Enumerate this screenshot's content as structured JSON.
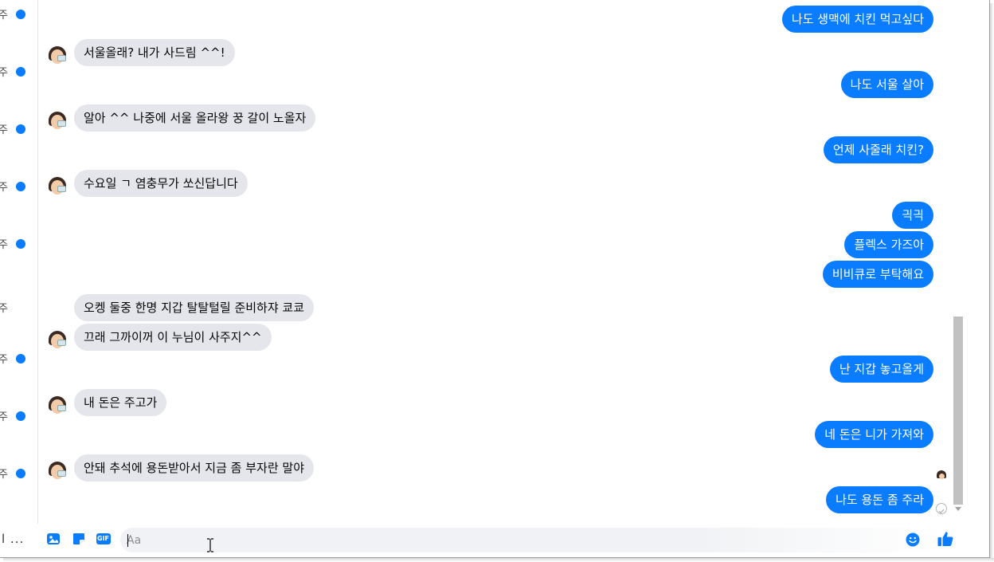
{
  "colors": {
    "accent": "#0a7cff",
    "incoming_bubble": "#e4e6eb",
    "unread_dot": "#0a7cff"
  },
  "sidebar": {
    "rows": [
      {
        "char": "주",
        "unread": true
      },
      {
        "char": "주",
        "unread": true
      },
      {
        "char": "주",
        "unread": true
      },
      {
        "char": "주",
        "unread": true
      },
      {
        "char": "주",
        "unread": true
      },
      {
        "char": "주",
        "unread": false
      },
      {
        "char": "주",
        "unread": true
      },
      {
        "char": "주",
        "unread": true
      },
      {
        "char": "주",
        "unread": true
      }
    ],
    "bottom_text": "l ..."
  },
  "messages": [
    {
      "dir": "out",
      "text": "나도 생맥에 치킨 먹고싶다"
    },
    {
      "dir": "in",
      "text": "서울올래? 내가 사드림 ^^!"
    },
    {
      "dir": "out",
      "text": "나도 서울 살아"
    },
    {
      "dir": "in",
      "text": "알아 ^^ 나중에 서울 올라왕 꿍 갈이 노올자"
    },
    {
      "dir": "out",
      "text": "언제 사줄래 치킨?"
    },
    {
      "dir": "in",
      "text": "수요일 ㄱ 염충무가 쏘신답니다"
    },
    {
      "dir": "out",
      "text": "긕긕"
    },
    {
      "dir": "out",
      "text": "플렉스 가즈아"
    },
    {
      "dir": "out",
      "text": "비비큐로 부탁해요"
    },
    {
      "dir": "in",
      "text": "오켕 둘중 한명 지갑 탈탈털릴 준비하쟈 쿄쿄"
    },
    {
      "dir": "in",
      "text": "끄래 그까이꺼 이 누님이 사주지^^"
    },
    {
      "dir": "out",
      "text": "난 지갑 놓고올게"
    },
    {
      "dir": "in",
      "text": "내 돈은 주고가"
    },
    {
      "dir": "out",
      "text": "네 돈은 니가 가져와"
    },
    {
      "dir": "in",
      "text": "안돼 추석에 용돈받아서 지금 좀 부자란 말야"
    },
    {
      "dir": "out",
      "text": "나도 용돈 좀 주라"
    }
  ],
  "composer": {
    "placeholder": "Aa",
    "tools": [
      "image-icon",
      "sticker-icon",
      "gif-icon"
    ],
    "gif_label": "GIF",
    "emoji_icon": "emoji-icon",
    "like_icon": "thumbs-up-icon"
  }
}
